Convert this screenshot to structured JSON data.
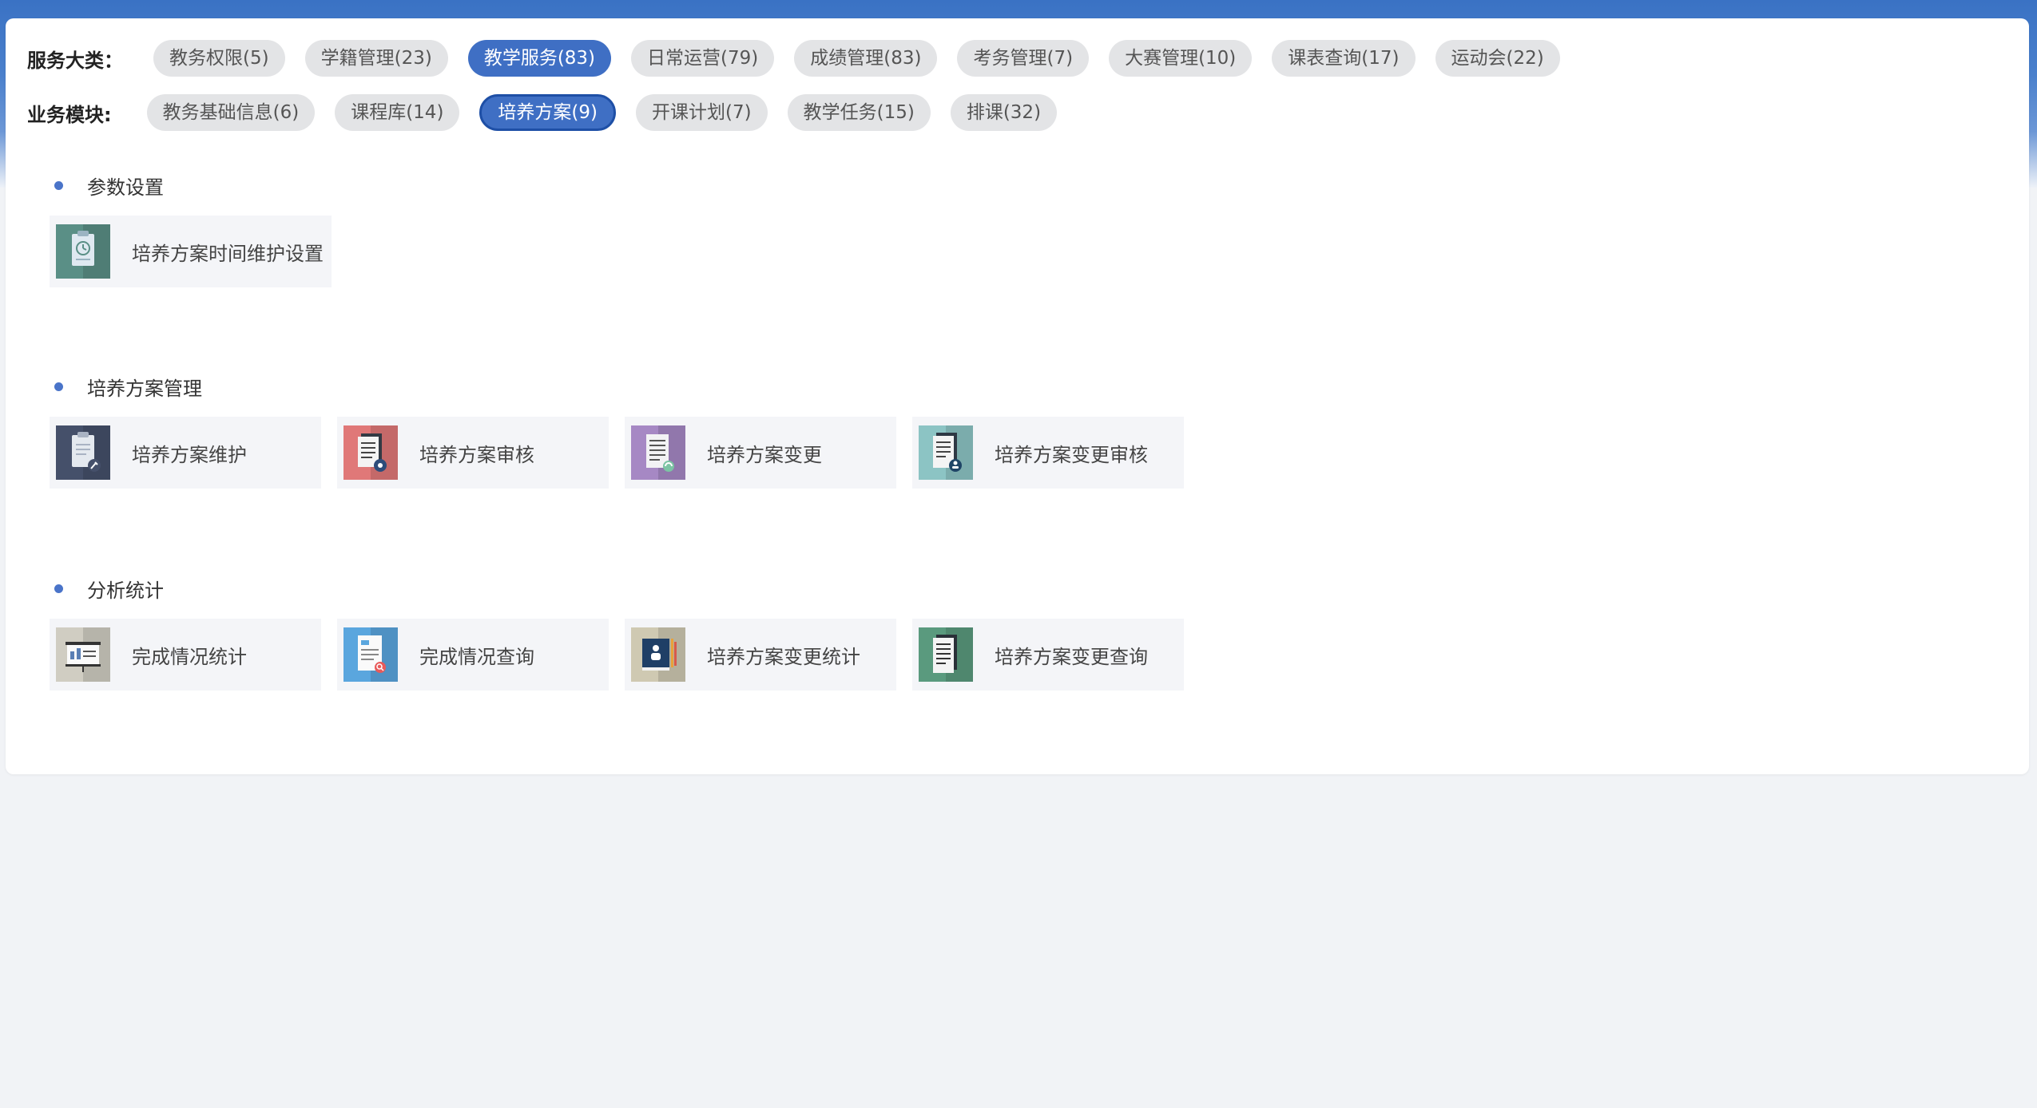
{
  "filters": {
    "category_label": "服务大类：",
    "module_label": "业务模块:",
    "categories": [
      {
        "label": "教务权限(5)",
        "active": false
      },
      {
        "label": "学籍管理(23)",
        "active": false
      },
      {
        "label": "教学服务(83)",
        "active": true
      },
      {
        "label": "日常运营(79)",
        "active": false
      },
      {
        "label": "成绩管理(83)",
        "active": false
      },
      {
        "label": "考务管理(7)",
        "active": false
      },
      {
        "label": "大赛管理(10)",
        "active": false
      },
      {
        "label": "课表查询(17)",
        "active": false
      },
      {
        "label": "运动会(22)",
        "active": false
      }
    ],
    "modules": [
      {
        "label": "教务基础信息(6)",
        "active": false
      },
      {
        "label": "课程库(14)",
        "active": false
      },
      {
        "label": "培养方案(9)",
        "active": true
      },
      {
        "label": "开课计划(7)",
        "active": false
      },
      {
        "label": "教学任务(15)",
        "active": false
      },
      {
        "label": "排课(32)",
        "active": false
      }
    ]
  },
  "sections": [
    {
      "title": "参数设置",
      "items": [
        {
          "label": "培养方案时间维护设置",
          "icon": "clipboard-clock-icon",
          "color": "#5a8f86"
        }
      ]
    },
    {
      "title": "培养方案管理",
      "items": [
        {
          "label": "培养方案维护",
          "icon": "clipboard-wrench-icon",
          "color": "#45506a"
        },
        {
          "label": "培养方案审核",
          "icon": "document-gear-icon",
          "color": "#e07878"
        },
        {
          "label": "培养方案变更",
          "icon": "document-refresh-icon",
          "color": "#a688c4"
        },
        {
          "label": "培养方案变更审核",
          "icon": "document-user-icon",
          "color": "#8cc4c4"
        }
      ]
    },
    {
      "title": "分析统计",
      "items": [
        {
          "label": "完成情况统计",
          "icon": "presentation-board-icon",
          "color": "#d0cdc2"
        },
        {
          "label": "完成情况查询",
          "icon": "document-search-icon",
          "color": "#5aa6de"
        },
        {
          "label": "培养方案变更统计",
          "icon": "book-user-icon",
          "color": "#cfc9b2"
        },
        {
          "label": "培养方案变更查询",
          "icon": "document-list-icon",
          "color": "#5a9a7e"
        }
      ]
    }
  ]
}
